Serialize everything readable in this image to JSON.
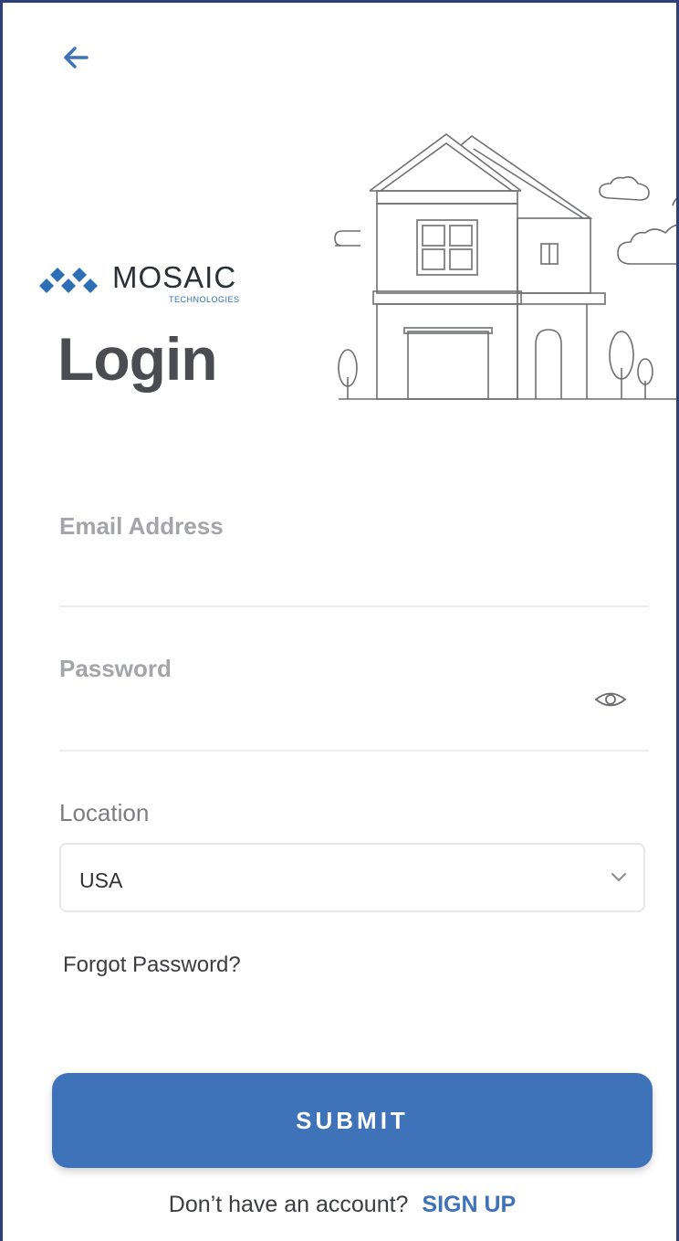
{
  "header": {
    "back_icon": "arrow-left-icon"
  },
  "brand": {
    "name": "MOSAIC",
    "tagline": "TECHNOLOGIES"
  },
  "page": {
    "title": "Login"
  },
  "form": {
    "email": {
      "label": "Email Address",
      "value": ""
    },
    "password": {
      "label": "Password",
      "value": "",
      "toggle_icon": "eye-icon"
    },
    "location": {
      "label": "Location",
      "selected": "USA",
      "dropdown_icon": "chevron-down-icon"
    },
    "forgot_label": "Forgot Password?",
    "submit_label": "SUBMIT"
  },
  "footer": {
    "prompt": "Don’t have an account?",
    "signup_label": "SIGN UP"
  },
  "colors": {
    "accent": "#3e72b9",
    "border": "#2f3f7a",
    "label_gray": "#a3a5a8",
    "title_gray": "#4a4c51"
  }
}
